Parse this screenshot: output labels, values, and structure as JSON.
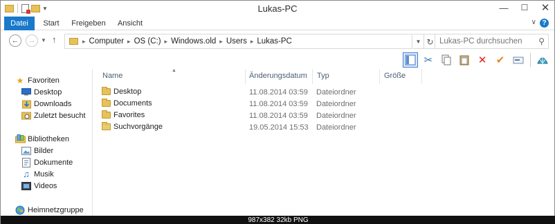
{
  "window": {
    "title": "Lukas-PC"
  },
  "ribbon": {
    "tabs": [
      {
        "label": "Datei"
      },
      {
        "label": "Start"
      },
      {
        "label": "Freigeben"
      },
      {
        "label": "Ansicht"
      }
    ]
  },
  "address": {
    "crumbs": [
      "Computer",
      "OS (C:)",
      "Windows.old",
      "Users",
      "Lukas-PC"
    ]
  },
  "search": {
    "placeholder": "Lukas-PC durchsuchen"
  },
  "toolbar": {
    "icons": [
      "layout-icon",
      "scissors-icon",
      "copy-icon",
      "paste-icon",
      "delete-icon",
      "checkmark-icon",
      "rename-icon",
      "shell-icon"
    ]
  },
  "nav": {
    "favorites": {
      "label": "Favoriten",
      "items": [
        "Desktop",
        "Downloads",
        "Zuletzt besucht"
      ]
    },
    "libraries": {
      "label": "Bibliotheken",
      "items": [
        "Bilder",
        "Dokumente",
        "Musik",
        "Videos"
      ]
    },
    "homegroup": {
      "label": "Heimnetzgruppe"
    }
  },
  "columns": {
    "name": "Name",
    "date": "Änderungsdatum",
    "type": "Typ",
    "size": "Größe"
  },
  "files": [
    {
      "name": "Desktop",
      "date": "11.08.2014 03:59",
      "type": "Dateiordner"
    },
    {
      "name": "Documents",
      "date": "11.08.2014 03:59",
      "type": "Dateiordner"
    },
    {
      "name": "Favorites",
      "date": "11.08.2014 03:59",
      "type": "Dateiordner"
    },
    {
      "name": "Suchvorgänge",
      "date": "19.05.2014 15:53",
      "type": "Dateiordner"
    }
  ],
  "caption": {
    "text": "987x382  32kb  PNG"
  },
  "colors": {
    "accent": "#1979ca",
    "folder": "#e7c25a"
  }
}
